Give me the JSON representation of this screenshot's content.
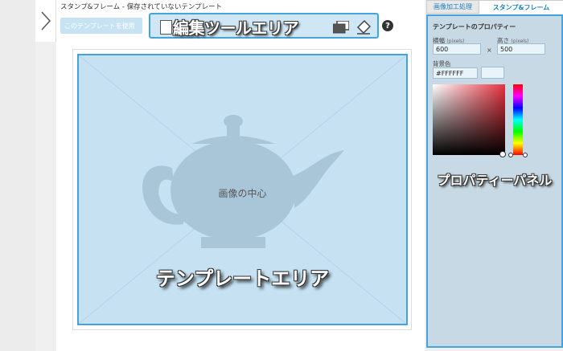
{
  "header": {
    "doc_title": "スタンプ&フレーム  -  保存されていないテンプレート",
    "use_template_button": "このテンプレートを使用"
  },
  "toolbar": {
    "area_label": "編集ツールエリア",
    "tools": [
      "new-document-icon",
      "duplicate-icon",
      "layer-icon",
      "eraser-icon"
    ],
    "help_label": "?"
  },
  "canvas": {
    "center_label": "画像の中心",
    "area_label": "テンプレートエリア"
  },
  "tabs": {
    "image_edit": "画像加工処理",
    "stamp_frame": "スタンプ&フレーム"
  },
  "properties": {
    "title": "テンプレートのプロパティー",
    "width_label": "横幅",
    "height_label": "高さ",
    "unit": "(pixels)",
    "width_value": "600",
    "times": "×",
    "height_value": "500",
    "bg_color_label": "背景色",
    "bg_color_value": "#FFFFFF",
    "area_label": "プロパティーパネル"
  },
  "colors": {
    "accent": "#44a3d8",
    "area_fill": "#c6e2f2",
    "panel_fill": "#c6d9e4"
  }
}
